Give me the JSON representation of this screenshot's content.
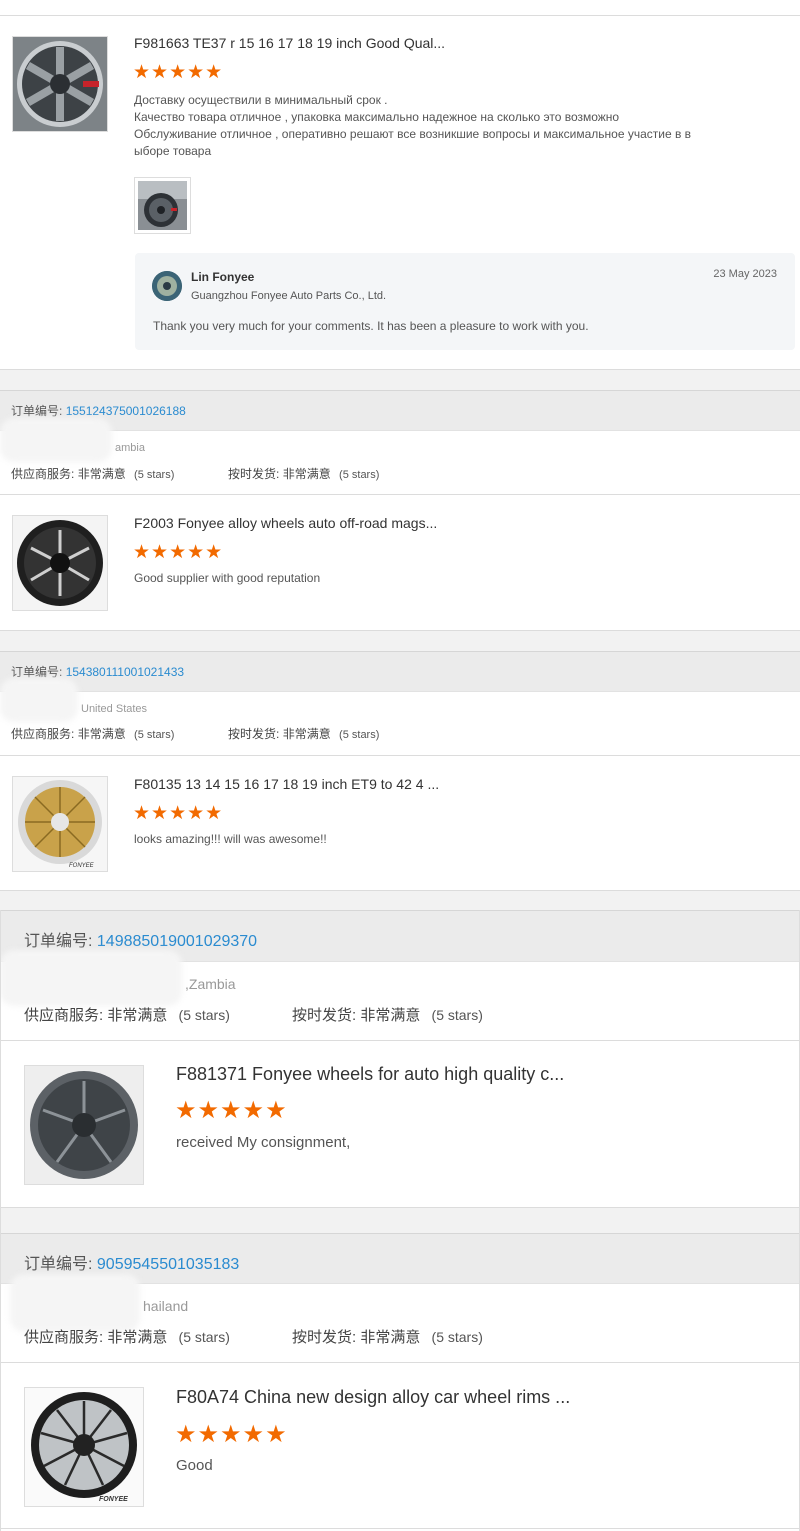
{
  "first_review": {
    "title": "F981663 TE37 r 15 16 17 18 19 inch Good Qual...",
    "stars": "★★★★★",
    "comment_lines": [
      "Доставку осуществили в минимальный срок .",
      "Качество товара отличное , упаковка максимально надежное на сколько это возможно",
      "Обслуживание отличное , оперативно решают все возникшие вопросы и максимальное участие в в",
      "ыборе товара"
    ],
    "reply": {
      "name": "Lin Fonyee",
      "company": "Guangzhou Fonyee Auto Parts Co., Ltd.",
      "date": "23 May 2023",
      "text": "Thank you very much for your comments. It has been a pleasure to work with you."
    }
  },
  "orders": [
    {
      "order_label": "订单编号:",
      "order_number": "155124375001026188",
      "country": "ambia",
      "supplier_label": "供应商服务:",
      "supplier_value": "非常满意",
      "supplier_stars": "(5 stars)",
      "shipping_label": "按时发货:",
      "shipping_value": "非常满意",
      "shipping_stars": "(5 stars)",
      "product_title": "F2003 Fonyee alloy wheels auto off-road mags...",
      "stars": "★★★★★",
      "comment": "Good supplier with good reputation"
    },
    {
      "order_label": "订单编号:",
      "order_number": "154380111001021433",
      "country": "United States",
      "supplier_label": "供应商服务:",
      "supplier_value": "非常满意",
      "supplier_stars": "(5 stars)",
      "shipping_label": "按时发货:",
      "shipping_value": "非常满意",
      "shipping_stars": "(5 stars)",
      "product_title": "F80135 13 14 15 16 17 18 19 inch ET9 to 42 4 ...",
      "stars": "★★★★★",
      "comment": "looks amazing!!! will was awesome!!"
    },
    {
      "order_label": "订单编号:",
      "order_number": "149885019001029370",
      "country": ",Zambia",
      "supplier_label": "供应商服务:",
      "supplier_value": "非常满意",
      "supplier_stars": "(5 stars)",
      "shipping_label": "按时发货:",
      "shipping_value": "非常满意",
      "shipping_stars": "(5 stars)",
      "product_title": "F881371 Fonyee wheels for auto high quality c...",
      "stars": "★★★★★",
      "comment": "received My consignment,"
    },
    {
      "order_label": "订单编号:",
      "order_number": "9059545501035183",
      "country": "hailand",
      "supplier_label": "供应商服务:",
      "supplier_value": "非常满意",
      "supplier_stars": "(5 stars)",
      "shipping_label": "按时发货:",
      "shipping_value": "非常满意",
      "shipping_stars": "(5 stars)",
      "product_title": "F80A74 China new design alloy car wheel rims ...",
      "stars": "★★★★★",
      "comment": "Good"
    }
  ],
  "wheel_logo_text": "FONYEE"
}
